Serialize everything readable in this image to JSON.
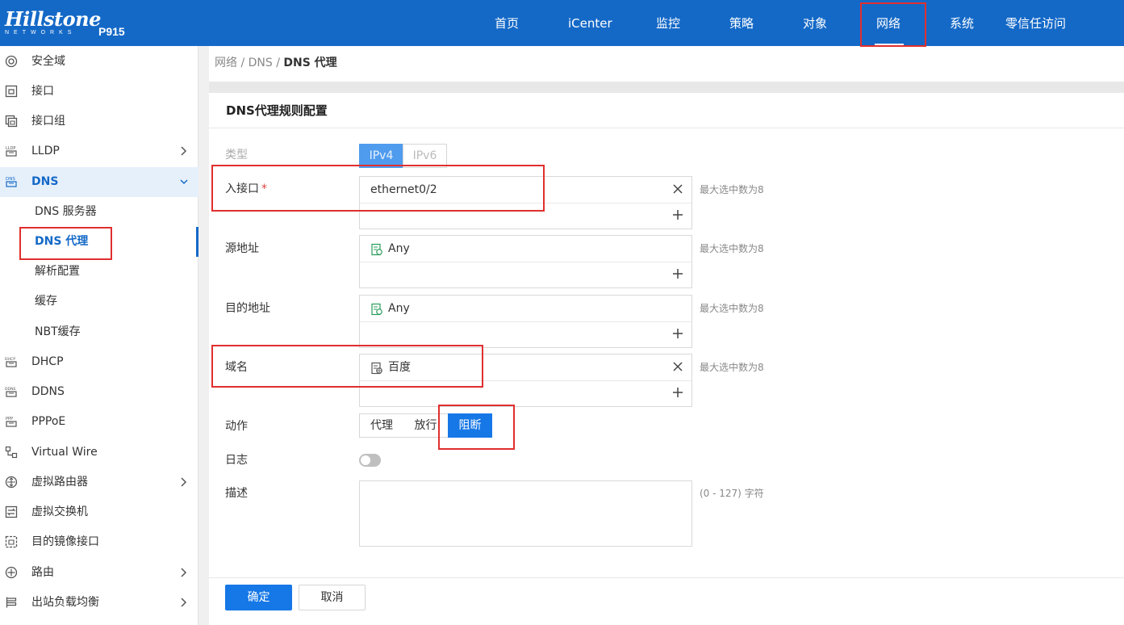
{
  "brand": {
    "logo": "Hillstone",
    "logo_sub": "NETWORKS",
    "model": "P915"
  },
  "nav": [
    "首页",
    "iCenter",
    "监控",
    "策略",
    "对象",
    "网络",
    "系统",
    "零信任访问"
  ],
  "nav_active": "网络",
  "sidebar": [
    {
      "label": "安全域",
      "icon": "zone-icon"
    },
    {
      "label": "接口",
      "icon": "interface-icon"
    },
    {
      "label": "接口组",
      "icon": "interface-group-icon"
    },
    {
      "label": "LLDP",
      "icon": "lldp-icon",
      "expandable": true
    },
    {
      "label": "DNS",
      "icon": "dns-icon",
      "expanded": true,
      "children": [
        "DNS 服务器",
        "DNS 代理",
        "解析配置",
        "缓存",
        "NBT缓存"
      ],
      "selected_child": "DNS 代理"
    },
    {
      "label": "DHCP",
      "icon": "dhcp-icon"
    },
    {
      "label": "DDNS",
      "icon": "ddns-icon"
    },
    {
      "label": "PPPoE",
      "icon": "pppoe-icon"
    },
    {
      "label": "Virtual Wire",
      "icon": "virtual-wire-icon"
    },
    {
      "label": "虚拟路由器",
      "icon": "virtual-router-icon",
      "expandable": true
    },
    {
      "label": "虚拟交换机",
      "icon": "virtual-switch-icon"
    },
    {
      "label": "目的镜像接口",
      "icon": "mirror-interface-icon"
    },
    {
      "label": "路由",
      "icon": "route-icon",
      "expandable": true
    },
    {
      "label": "出站负载均衡",
      "icon": "outbound-lb-icon",
      "expandable": true
    }
  ],
  "breadcrumb": {
    "parts": "网络 / DNS / ",
    "current": "DNS 代理"
  },
  "form": {
    "title": "DNS代理规则配置",
    "type_label": "类型",
    "type_options": [
      "IPv4",
      "IPv6"
    ],
    "type_selected": "IPv4",
    "ingress_label": "入接口",
    "ingress_required": "*",
    "ingress_value": "ethernet0/2",
    "src_label": "源地址",
    "src_value": "Any",
    "dst_label": "目的地址",
    "dst_value": "Any",
    "domain_label": "域名",
    "domain_value": "百度",
    "max_hint": "最大选中数为8",
    "action_label": "动作",
    "action_options": [
      "代理",
      "放行",
      "阻断"
    ],
    "action_selected": "阻断",
    "log_label": "日志",
    "log_enabled": false,
    "desc_label": "描述",
    "desc_value": "",
    "desc_hint": "(0 - 127) 字符"
  },
  "buttons": {
    "ok": "确定",
    "cancel": "取消"
  },
  "colors": {
    "primary": "#1469c7",
    "button": "#1677e6",
    "highlight": "#e02f2f"
  }
}
